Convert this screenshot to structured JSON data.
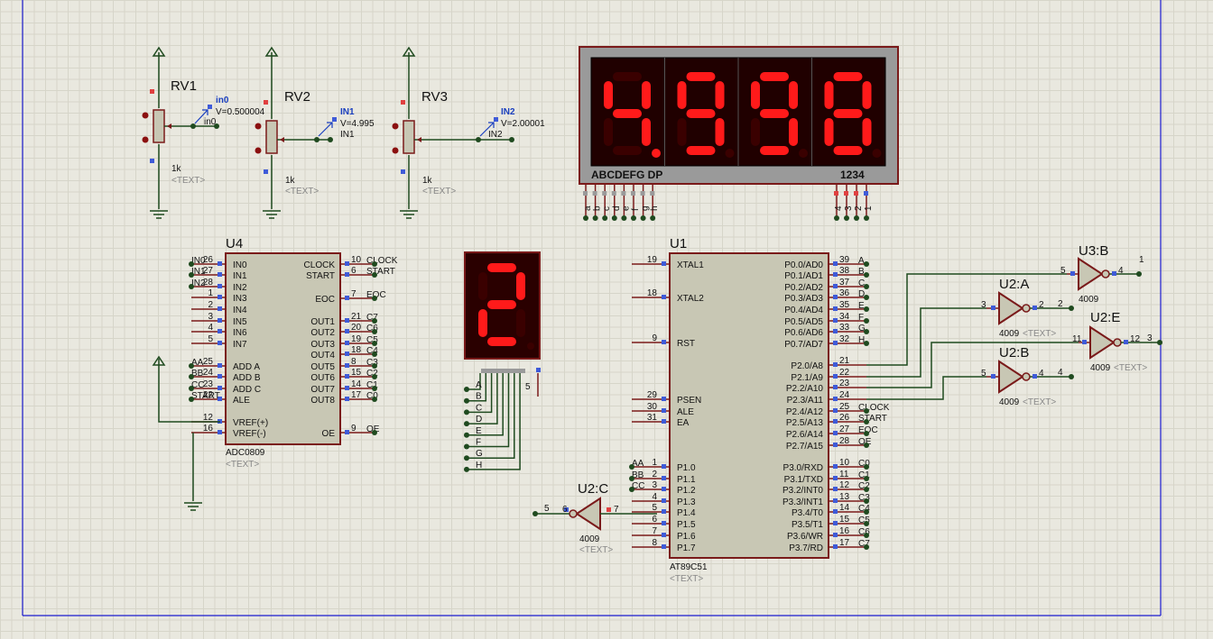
{
  "rv": [
    {
      "ref": "RV1",
      "value": "1k",
      "text": "<TEXT>",
      "probe": "in0",
      "probe_v": "V=0.500004",
      "net": "in0"
    },
    {
      "ref": "RV2",
      "value": "1k",
      "text": "<TEXT>",
      "probe": "IN1",
      "probe_v": "V=4.995",
      "net": "IN1"
    },
    {
      "ref": "RV3",
      "value": "1k",
      "text": "<TEXT>",
      "probe": "IN2",
      "probe_v": "V=2.00001",
      "net": "IN2"
    }
  ],
  "display4": {
    "digits": "4998",
    "seg_label": "ABCDEFG  DP",
    "dig_label": "1234",
    "pins_left": [
      "a",
      "b",
      "c",
      "d",
      "e",
      "f",
      "g",
      "h"
    ],
    "pins_right": [
      "4",
      "3",
      "2",
      "1"
    ],
    "seg_on": [
      [
        0,
        1,
        1,
        0,
        0,
        1,
        1
      ],
      [
        1,
        1,
        1,
        1,
        0,
        1,
        1
      ],
      [
        1,
        1,
        1,
        1,
        0,
        1,
        1
      ],
      [
        1,
        1,
        1,
        1,
        1,
        1,
        1
      ]
    ]
  },
  "display1": {
    "digit": "2",
    "pins": [
      "A",
      "B",
      "C",
      "D",
      "E",
      "F",
      "G",
      "H"
    ],
    "com_pin": "5",
    "seg_on": [
      1,
      1,
      0,
      1,
      1,
      0,
      1
    ]
  },
  "u4": {
    "ref": "U4",
    "part": "ADC0809",
    "text": "<TEXT>",
    "left": [
      {
        "num": "26",
        "name": "IN0",
        "net": "IN0"
      },
      {
        "num": "27",
        "name": "IN1",
        "net": "IN1"
      },
      {
        "num": "28",
        "name": "IN2",
        "net": "IN2"
      },
      {
        "num": "1",
        "name": "IN3",
        "net": ""
      },
      {
        "num": "2",
        "name": "IN4",
        "net": ""
      },
      {
        "num": "3",
        "name": "IN5",
        "net": ""
      },
      {
        "num": "4",
        "name": "IN6",
        "net": ""
      },
      {
        "num": "5",
        "name": "IN7",
        "net": ""
      },
      {
        "num": "25",
        "name": "ADD A",
        "net": "AA"
      },
      {
        "num": "24",
        "name": "ADD B",
        "net": "BB"
      },
      {
        "num": "23",
        "name": "ADD C",
        "net": "CC"
      },
      {
        "num": "22",
        "name": "ALE",
        "net": "START"
      },
      {
        "num": "12",
        "name": "VREF(+)",
        "net": ""
      },
      {
        "num": "16",
        "name": "VREF(-)",
        "net": ""
      }
    ],
    "right": [
      {
        "num": "10",
        "name": "CLOCK",
        "net": "CLOCK"
      },
      {
        "num": "6",
        "name": "START",
        "net": "START"
      },
      {
        "num": "7",
        "name": "EOC",
        "net": "EOC"
      },
      {
        "num": "21",
        "name": "OUT1",
        "net": "C7"
      },
      {
        "num": "20",
        "name": "OUT2",
        "net": "C6"
      },
      {
        "num": "19",
        "name": "OUT3",
        "net": "C5"
      },
      {
        "num": "18",
        "name": "OUT4",
        "net": "C4"
      },
      {
        "num": "8",
        "name": "OUT5",
        "net": "C3"
      },
      {
        "num": "15",
        "name": "OUT6",
        "net": "C2"
      },
      {
        "num": "14",
        "name": "OUT7",
        "net": "C1"
      },
      {
        "num": "17",
        "name": "OUT8",
        "net": "C0"
      },
      {
        "num": "9",
        "name": "OE",
        "net": "OE"
      }
    ]
  },
  "u1": {
    "ref": "U1",
    "part": "AT89C51",
    "text": "<TEXT>",
    "left": [
      {
        "num": "19",
        "name": "XTAL1",
        "net": ""
      },
      {
        "num": "18",
        "name": "XTAL2",
        "net": ""
      },
      {
        "num": "9",
        "name": "RST",
        "net": ""
      },
      {
        "num": "29",
        "name": "PSEN",
        "net": ""
      },
      {
        "num": "30",
        "name": "ALE",
        "net": ""
      },
      {
        "num": "31",
        "name": "EA",
        "net": ""
      },
      {
        "num": "1",
        "name": "P1.0",
        "net": "AA"
      },
      {
        "num": "2",
        "name": "P1.1",
        "net": "BB"
      },
      {
        "num": "3",
        "name": "P1.2",
        "net": "CC"
      },
      {
        "num": "4",
        "name": "P1.3",
        "net": ""
      },
      {
        "num": "5",
        "name": "P1.4",
        "net": ""
      },
      {
        "num": "6",
        "name": "P1.5",
        "net": ""
      },
      {
        "num": "7",
        "name": "P1.6",
        "net": ""
      },
      {
        "num": "8",
        "name": "P1.7",
        "net": ""
      }
    ],
    "right": [
      {
        "num": "39",
        "name": "P0.0/AD0",
        "net": "A"
      },
      {
        "num": "38",
        "name": "P0.1/AD1",
        "net": "B"
      },
      {
        "num": "37",
        "name": "P0.2/AD2",
        "net": "C"
      },
      {
        "num": "36",
        "name": "P0.3/AD3",
        "net": "D"
      },
      {
        "num": "35",
        "name": "P0.4/AD4",
        "net": "E"
      },
      {
        "num": "34",
        "name": "P0.5/AD5",
        "net": "F"
      },
      {
        "num": "33",
        "name": "P0.6/AD6",
        "net": "G"
      },
      {
        "num": "32",
        "name": "P0.7/AD7",
        "net": "H"
      },
      {
        "num": "21",
        "name": "P2.0/A8",
        "net": ""
      },
      {
        "num": "22",
        "name": "P2.1/A9",
        "net": ""
      },
      {
        "num": "23",
        "name": "P2.2/A10",
        "net": ""
      },
      {
        "num": "24",
        "name": "P2.3/A11",
        "net": ""
      },
      {
        "num": "25",
        "name": "P2.4/A12",
        "net": "CLOCK"
      },
      {
        "num": "26",
        "name": "P2.5/A13",
        "net": "START"
      },
      {
        "num": "27",
        "name": "P2.6/A14",
        "net": "EOC"
      },
      {
        "num": "28",
        "name": "P2.7/A15",
        "net": "OE"
      },
      {
        "num": "10",
        "name": "P3.0/RXD",
        "net": "C0"
      },
      {
        "num": "11",
        "name": "P3.1/TXD",
        "net": "C1"
      },
      {
        "num": "12",
        "name": "P3.2/INT0",
        "net": "C2"
      },
      {
        "num": "13",
        "name": "P3.3/INT1",
        "net": "C3"
      },
      {
        "num": "14",
        "name": "P3.4/T0",
        "net": "C4"
      },
      {
        "num": "15",
        "name": "P3.5/T1",
        "net": "C5"
      },
      {
        "num": "16",
        "name": "P3.6/WR",
        "net": "C6"
      },
      {
        "num": "17",
        "name": "P3.7/RD",
        "net": "C7"
      }
    ]
  },
  "gates": [
    {
      "ref": "U3:B",
      "part": "4009",
      "text": "",
      "in_pin": "5",
      "out_pin": "4",
      "out_net": "1"
    },
    {
      "ref": "U2:A",
      "part": "4009",
      "text": "<TEXT>",
      "in_pin": "3",
      "out_pin": "2",
      "out_net": "2"
    },
    {
      "ref": "U2:E",
      "part": "4009",
      "text": "<TEXT>",
      "in_pin": "11",
      "out_pin": "12",
      "out_net": "3"
    },
    {
      "ref": "U2:B",
      "part": "4009",
      "text": "<TEXT>",
      "in_pin": "5",
      "out_pin": "4",
      "out_net": "4"
    },
    {
      "ref": "U2:C",
      "part": "4009",
      "text": "<TEXT>",
      "in_pin": "7",
      "out_pin": "6",
      "out_net": "5"
    }
  ]
}
